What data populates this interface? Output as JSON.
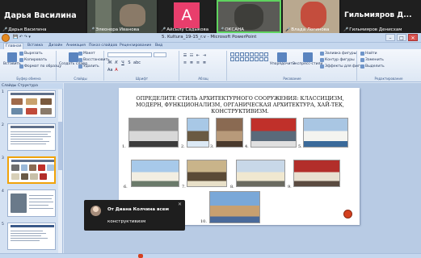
{
  "zoom": {
    "participants": [
      {
        "name": "Дарья Василина",
        "big_label": "Дарья Василина",
        "muted": true
      },
      {
        "name": "Элеонора Иванова",
        "muted": true
      },
      {
        "name": "Айсылу Садыкова",
        "avatar_letter": "А",
        "avatar_color": "#e83e6c",
        "muted": true
      },
      {
        "name": "ОКСАНА",
        "muted": true,
        "active_speaker": true
      },
      {
        "name": "Влада Логинова",
        "muted": true
      },
      {
        "name": "Гильмияров Денисхам",
        "big_label": "Гильмияров Д...",
        "muted": true
      }
    ]
  },
  "powerpoint": {
    "window_title": "5. Kultura_19-15_r.v - Microsoft PowerPoint",
    "tabs": [
      "Главная",
      "Вставка",
      "Дизайн",
      "Анимация",
      "Показ слайдов",
      "Рецензирование",
      "Вид"
    ],
    "active_tab": "Главная",
    "ribbon": {
      "groups": [
        "Буфер обмена",
        "Слайды",
        "Шрифт",
        "Абзац",
        "Рисование",
        "Редактирование"
      ],
      "paste": "Вставить",
      "cut": "Вырезать",
      "copy": "Копировать",
      "format_painter": "Формат по образцу",
      "new_slide": "Создать слайд",
      "layout": "Макет",
      "reset": "Восстановить",
      "delete": "Удалить",
      "arrange": "Упорядочить",
      "quick_styles": "Экспресс-стили",
      "shape_fill": "Заливка фигуры",
      "shape_outline": "Контур фигуры",
      "shape_effects": "Эффекты для фигур",
      "find": "Найти",
      "replace": "Заменить",
      "select": "Выделить"
    },
    "pane_tabs": [
      "Слайды",
      "Структура"
    ],
    "slide_numbers": [
      "1",
      "2",
      "3",
      "4",
      "5"
    ],
    "selected_slide": 3,
    "slide": {
      "heading": "ОПРЕДЕЛИТЕ СТИЛЬ АРХИТЕКТУРНОГО СООРУЖЕНИЯ: КЛАССИЦИЗМ, МОДЕРН, ФУНКЦИОНАЛИЗМ, ОРГАНИЧЕСКАЯ АРХИТЕКТУРА, ХАЙ-ТЕК, КОНСТРУКТИВИЗМ.",
      "images": [
        {
          "label": "1.",
          "subject": "mansion",
          "colors": [
            "#8c8c8c",
            "#d8d8d8",
            "#3c3c3c"
          ]
        },
        {
          "label": "2.",
          "subject": "eiffel-tower",
          "colors": [
            "#a8c8e6",
            "#6a5a42",
            "#dce9f5"
          ]
        },
        {
          "label": "3.",
          "subject": "stone-building",
          "colors": [
            "#8a6a52",
            "#b89a7a",
            "#4a3a2e"
          ]
        },
        {
          "label": "4.",
          "subject": "hi-tech-pipes",
          "colors": [
            "#c0302a",
            "#5a6a7a",
            "#e0e0e0"
          ]
        },
        {
          "label": "5.",
          "subject": "sydney-opera-house",
          "colors": [
            "#a9c6e3",
            "#f4f4f0",
            "#3a6a9a"
          ]
        },
        {
          "label": "6.",
          "subject": "classicism-palace",
          "colors": [
            "#a7c9ea",
            "#f2eee2",
            "#6a7a6a"
          ]
        },
        {
          "label": "7.",
          "subject": "constructivism-building",
          "colors": [
            "#c9b48a",
            "#5a4a36",
            "#e8e0c8"
          ]
        },
        {
          "label": "8.",
          "subject": "colonnade-palace",
          "colors": [
            "#c8d8e8",
            "#f0e8d0",
            "#6a6a60"
          ]
        },
        {
          "label": "9.",
          "subject": "art-nouveau-building",
          "colors": [
            "#b22e2a",
            "#e8e0d0",
            "#5a4a40"
          ]
        },
        {
          "label": "10.",
          "subject": "cathedral-domes",
          "colors": [
            "#7aa8d8",
            "#c8a070",
            "#4a6a9a"
          ]
        }
      ]
    }
  },
  "notification": {
    "from": "От Диана Колчина всем",
    "message": "конструктивизм"
  }
}
